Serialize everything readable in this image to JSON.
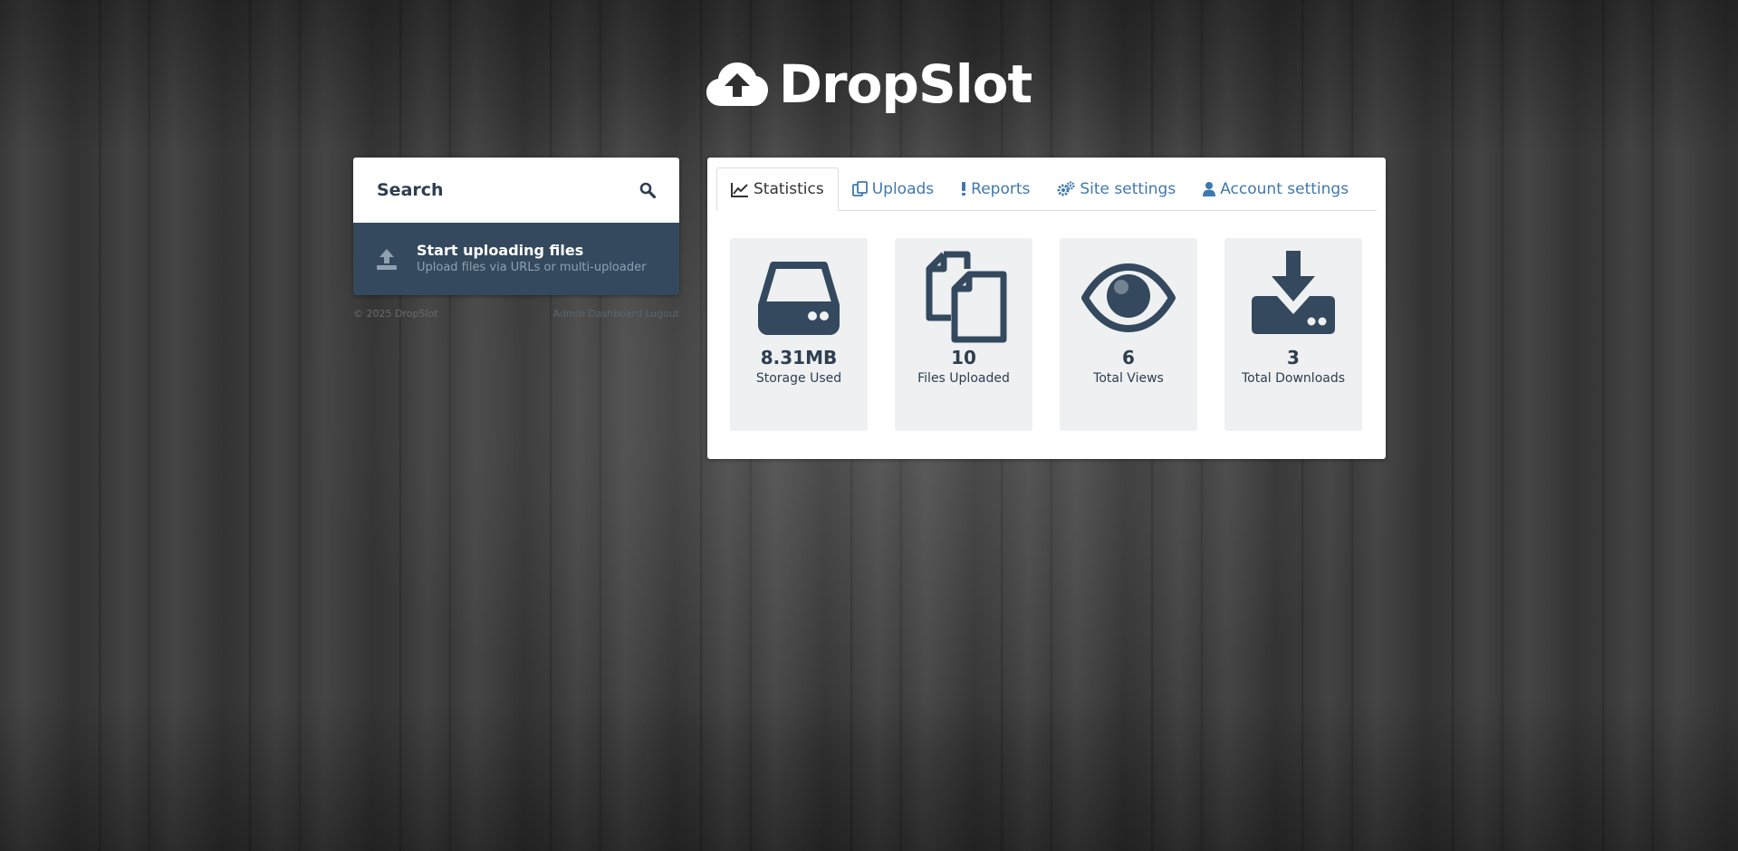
{
  "app": {
    "logo_text": "DropSlot",
    "logo_icon": "cloud-upload-icon"
  },
  "sidebar": {
    "search_label": "Search",
    "upload_title": "Start uploading files",
    "upload_subtitle": "Upload files via URLs or multi-uploader",
    "footer_copyright": "© 2025 DropSlot",
    "footer_link": "Admin Dashboard Logout"
  },
  "tabs": [
    {
      "label": "Statistics",
      "icon": "line-chart-icon",
      "active": true
    },
    {
      "label": "Uploads",
      "icon": "copy-icon",
      "active": false
    },
    {
      "label": "Reports",
      "icon": "exclamation-icon",
      "active": false
    },
    {
      "label": "Site settings",
      "icon": "gears-icon",
      "active": false
    },
    {
      "label": "Account settings",
      "icon": "user-icon",
      "active": false
    }
  ],
  "stats": [
    {
      "value": "8.31MB",
      "label": "Storage Used",
      "icon": "hdd-icon"
    },
    {
      "value": "10",
      "label": "Files Uploaded",
      "icon": "files-icon"
    },
    {
      "value": "6",
      "label": "Total Views",
      "icon": "eye-icon"
    },
    {
      "value": "3",
      "label": "Total Downloads",
      "icon": "download-icon"
    }
  ],
  "colors": {
    "primary_dark": "#34495e",
    "text_dark": "#2e3e50",
    "link_blue": "#3f78ad",
    "stat_bg": "#eef0f2"
  }
}
